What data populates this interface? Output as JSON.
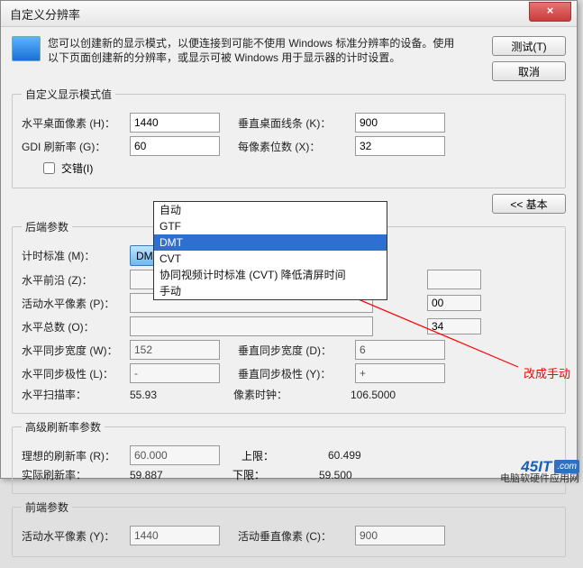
{
  "window": {
    "title": "自定义分辨率",
    "close_label": "×"
  },
  "buttons": {
    "test": "测试(T)",
    "cancel": "取消",
    "basic": "<< 基本"
  },
  "info": "您可以创建新的显示模式，以便连接到可能不使用 Windows 标准分辨率的设备。使用以下页面创建新的分辨率，或显示可被 Windows 用于显示器的计时设置。",
  "group_custom": {
    "legend": "自定义显示模式值",
    "h_pixels_lbl": "水平桌面像素 (H)：",
    "h_pixels_val": "1440",
    "v_lines_lbl": "垂直桌面线条 (K)：",
    "v_lines_val": "900",
    "refresh_lbl": "GDI 刷新率 (G)：",
    "refresh_val": "60",
    "bpp_lbl": "每像素位数 (X)：",
    "bpp_val": "32",
    "interlace_lbl": "交错(I)"
  },
  "group_backend": {
    "legend": "后端参数",
    "timing_std_lbl": "计时标准 (M)：",
    "timing_std_val": "DMT",
    "options": [
      "自动",
      "GTF",
      "DMT",
      "CVT",
      "协同视频计时标准 (CVT) 降低清屏时间",
      "手动"
    ],
    "h_frontporch_lbl": "水平前沿 (Z)：",
    "h_frontporch_val": "",
    "v_frontporch_val": "",
    "h_active_lbl": "活动水平像素 (P)：",
    "h_active_val": "",
    "v_active_suffix": "00",
    "h_total_lbl": "水平总数 (O)：",
    "h_total_val": "",
    "v_total_suffix": "34",
    "h_sync_w_lbl": "水平同步宽度 (W)：",
    "h_sync_w_val": "152",
    "v_sync_w_lbl": "垂直同步宽度 (D)：",
    "v_sync_w_val": "6",
    "h_sync_p_lbl": "水平同步极性 (L)：",
    "h_sync_p_val": "-",
    "v_sync_p_lbl": "垂直同步极性 (Y)：",
    "v_sync_p_val": "+",
    "h_scan_lbl": "水平扫描率：",
    "h_scan_val": "55.93",
    "pixel_clock_lbl": "像素时钟：",
    "pixel_clock_val": "106.5000"
  },
  "group_advrefresh": {
    "legend": "高级刷新率参数",
    "ideal_lbl": "理想的刷新率 (R)：",
    "ideal_val": "60.000",
    "upper_lbl": "上限：",
    "upper_val": "60.499",
    "lower_lbl": "下限：",
    "lower_val": "59.500",
    "actual_lbl": "实际刷新率：",
    "actual_val": "59.887"
  },
  "group_front": {
    "legend": "前端参数",
    "h_active_lbl": "活动水平像素 (Y)：",
    "h_active_val": "1440",
    "v_active_lbl": "活动垂直像素 (C)：",
    "v_active_val": "900"
  },
  "annotation": "改成手动",
  "watermark": {
    "logo": "45IT",
    "dotcom": ".com",
    "sub": "电脑软硬件应用网"
  }
}
